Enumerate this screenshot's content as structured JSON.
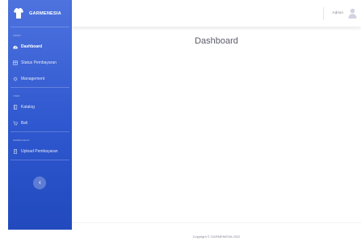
{
  "brand": {
    "name": "GARMENESIA"
  },
  "sidebar": {
    "sections": [
      {
        "heading": "ADMIN",
        "items": [
          {
            "label": "Dashboard",
            "icon": "dashboard-icon",
            "active": true
          },
          {
            "label": "Status Pembayaran",
            "icon": "table-icon",
            "active": false
          },
          {
            "label": "Management",
            "icon": "users-icon",
            "active": false
          }
        ]
      },
      {
        "heading": "USER",
        "items": [
          {
            "label": "Katalog",
            "icon": "book-icon",
            "active": false
          },
          {
            "label": "Beli",
            "icon": "cart-icon",
            "active": false
          }
        ]
      },
      {
        "heading": "PEMBAYARAN",
        "items": [
          {
            "label": "Upload Pembayaran",
            "icon": "upload-icon",
            "active": false
          }
        ]
      }
    ],
    "toggle_icon": "chevron-left-icon"
  },
  "topbar": {
    "username": "Admin",
    "avatar_icon": "user-avatar-icon"
  },
  "main": {
    "title": "Dashboard"
  },
  "footer": {
    "copyright": "Copyright © GARMENESIA 2022"
  },
  "colors": {
    "sidebar_top": "#4e73df",
    "sidebar_bottom": "#224abe",
    "title_text": "#5a5c69",
    "muted_text": "#858796"
  }
}
